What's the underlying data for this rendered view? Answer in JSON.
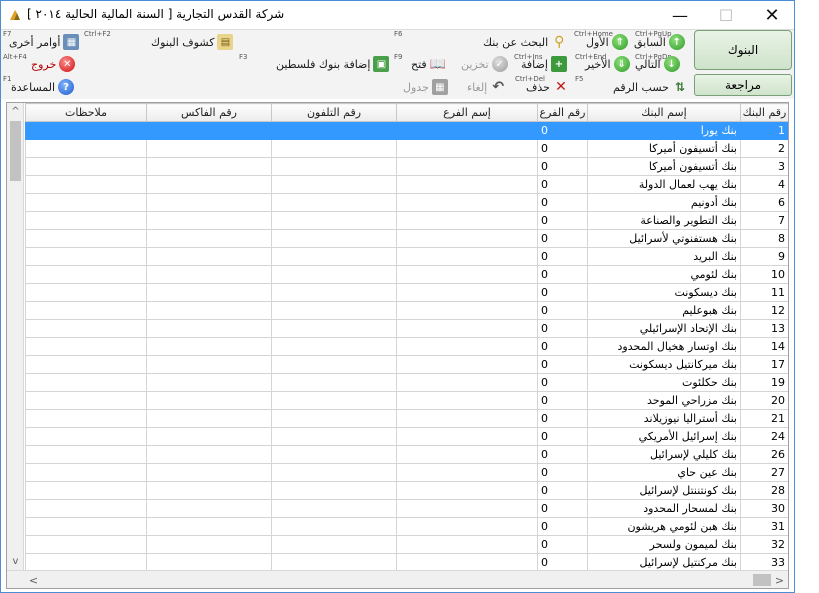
{
  "window": {
    "title": "شركة القدس التجارية  [ السنة المالية الحالية ٢٠١٤ ]",
    "min_glyph": "—",
    "max_glyph": "☐",
    "close_glyph": "✕"
  },
  "toolbar": {
    "hk_f7": "F7",
    "other_orders": "أوامر أخرى",
    "hk_other": "Ctrl+F2",
    "bank_statements": "كشوف البنوك",
    "hk_f6": "F6",
    "search_bank": "البحث عن بنك",
    "hk_search": "Ctrl+Home",
    "first": "الأول",
    "hk_prev": "Ctrl+PgUp",
    "previous": "السابق",
    "hk_altf4": "Alt+F4",
    "exit": "خروج",
    "hk_f3": "F3",
    "add_palestine_banks": "إضافة بنوك فلسطين",
    "hk_f9": "F9",
    "open": "فتح",
    "store": "تخزين",
    "hk_add": "Ctrl+Ins",
    "add": "إضافة",
    "hk_last": "Ctrl+End",
    "last": "الأخير",
    "hk_next": "Ctrl+PgDn",
    "next": "التالي",
    "hk_f1": "F1",
    "help": "المساعدة",
    "table": "جدول",
    "cancel": "إلغاء",
    "hk_del": "Ctrl+Del",
    "delete": "حذف",
    "hk_f5": "F5",
    "sort_by_number": "حسب الرقم",
    "banks_button": "البنوك",
    "review_button": "مراجعة"
  },
  "grid": {
    "columns": [
      "رقم البنك",
      "إسم البنك",
      "رقم الفرع",
      "إسم الفرع",
      "رقم التلفون",
      "رقم الفاكس",
      "ملاحظات"
    ],
    "rows": [
      {
        "no": "1",
        "name": "بنك يورا",
        "branch": "0"
      },
      {
        "no": "2",
        "name": "بنك أتسيفون أميركا",
        "branch": "0"
      },
      {
        "no": "3",
        "name": "بنك أتسيفون أميركا",
        "branch": "0"
      },
      {
        "no": "4",
        "name": "بنك يهب لعمال الدولة",
        "branch": "0"
      },
      {
        "no": "6",
        "name": "بنك أدونيم",
        "branch": "0"
      },
      {
        "no": "7",
        "name": "بنك التطوير والصناعة",
        "branch": "0"
      },
      {
        "no": "8",
        "name": "بنك هستفنوتي لأسرائيل",
        "branch": "0"
      },
      {
        "no": "9",
        "name": "بنك البريد",
        "branch": "0"
      },
      {
        "no": "10",
        "name": "بنك لئومي",
        "branch": "0"
      },
      {
        "no": "11",
        "name": "بنك ديسكونت",
        "branch": "0"
      },
      {
        "no": "12",
        "name": "بنك هبوعليم",
        "branch": "0"
      },
      {
        "no": "13",
        "name": "بنك الإتحاد الإسرائيلي",
        "branch": "0"
      },
      {
        "no": "14",
        "name": "بنك اوتسار هخيال المحدود",
        "branch": "0"
      },
      {
        "no": "17",
        "name": "بنك ميركانتيل ديسكونت",
        "branch": "0"
      },
      {
        "no": "19",
        "name": "بنك حكلئوت",
        "branch": "0"
      },
      {
        "no": "20",
        "name": "بنك مزراحي الموحد",
        "branch": "0"
      },
      {
        "no": "21",
        "name": "بنك أستراليا نيوزيلاند",
        "branch": "0"
      },
      {
        "no": "24",
        "name": "بنك إسرائيل الأمريكي",
        "branch": "0"
      },
      {
        "no": "26",
        "name": "بنك كليلي لإسرائيل",
        "branch": "0"
      },
      {
        "no": "27",
        "name": "بنك عين حاي",
        "branch": "0"
      },
      {
        "no": "28",
        "name": "بنك كونتننتل لإسرائيل",
        "branch": "0"
      },
      {
        "no": "30",
        "name": "بنك لمسحار المحدود",
        "branch": "0"
      },
      {
        "no": "31",
        "name": "بنك هبن لئومي هريشون",
        "branch": "0"
      },
      {
        "no": "32",
        "name": "بنك لميمون ولسحر",
        "branch": "0"
      },
      {
        "no": "33",
        "name": "بنك مركنتيل لإسرائيل",
        "branch": "0"
      }
    ]
  },
  "scroll": {
    "up": "^",
    "down": "v",
    "left": "<",
    "right": ">"
  }
}
